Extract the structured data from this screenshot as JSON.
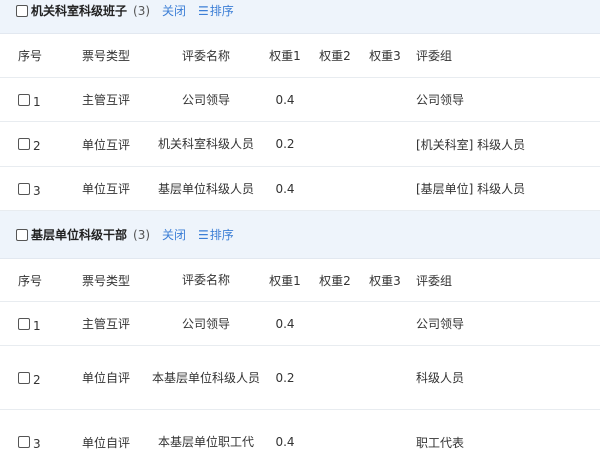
{
  "columns": [
    "序号",
    "票号类型",
    "评委名称",
    "权重1",
    "权重2",
    "权重3",
    "评委组"
  ],
  "groups": [
    {
      "title": "机关科室科级班子",
      "count": "(3)",
      "close_label": "关闭",
      "sort_label": "排序",
      "rows": [
        {
          "idx": "1",
          "type": "主管互评",
          "name": "公司领导",
          "w1": "0.4",
          "w2": "",
          "w3": "",
          "group": "公司领导"
        },
        {
          "idx": "2",
          "type": "单位互评",
          "name": "机关科室科级人员",
          "w1": "0.2",
          "w2": "",
          "w3": "",
          "group": "[机关科室] 科级人员"
        },
        {
          "idx": "3",
          "type": "单位互评",
          "name": "基层单位科级人员",
          "w1": "0.4",
          "w2": "",
          "w3": "",
          "group": "[基层单位] 科级人员"
        }
      ]
    },
    {
      "title": "基层单位科级干部",
      "count": "(3)",
      "close_label": "关闭",
      "sort_label": "排序",
      "rows": [
        {
          "idx": "1",
          "type": "主管互评",
          "name": "公司领导",
          "w1": "0.4",
          "w2": "",
          "w3": "",
          "group": "公司领导"
        },
        {
          "idx": "2",
          "type": "单位自评",
          "name": "本基层单位科级人员",
          "w1": "0.2",
          "w2": "",
          "w3": "",
          "group": "科级人员"
        },
        {
          "idx": "3",
          "type": "单位自评",
          "name": "本基层单位职工代",
          "w1": "0.4",
          "w2": "",
          "w3": "",
          "group": "职工代表"
        }
      ]
    }
  ]
}
